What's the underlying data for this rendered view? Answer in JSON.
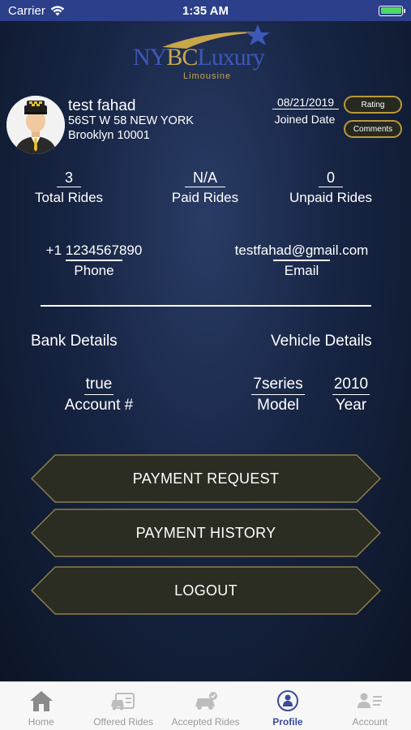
{
  "status_bar": {
    "carrier": "Carrier",
    "time": "1:35 AM"
  },
  "logo": {
    "main_blue": "NY",
    "main_gold": "BC",
    "main_rest": "Luxury",
    "sub": "Limousine"
  },
  "profile": {
    "name": "test fahad",
    "address_line1": "56ST W 58 NEW YORK",
    "address_line2": "Brooklyn 10001",
    "joined_date": "08/21/2019",
    "joined_label": "Joined Date",
    "rating_button": "Rating",
    "comments_button": "Comments"
  },
  "stats": [
    {
      "value": "3",
      "label": "Total Rides"
    },
    {
      "value": "N/A",
      "label": "Paid Rides"
    },
    {
      "value": "0",
      "label": "Unpaid Rides"
    }
  ],
  "contact": {
    "phone": "+1 1234567890",
    "phone_label": "Phone",
    "email": "testfahad@gmail.com",
    "email_label": "Email"
  },
  "bank": {
    "title": "Bank Details",
    "account_value": "true",
    "account_label": "Account #"
  },
  "vehicle": {
    "title": "Vehicle Details",
    "model_value": "7series",
    "model_label": "Model",
    "year_value": "2010",
    "year_label": "Year"
  },
  "actions": {
    "payment_request": "PAYMENT REQUEST",
    "payment_history": "PAYMENT HISTORY",
    "logout": "LOGOUT"
  },
  "tabs": [
    {
      "label": "Home",
      "icon": "home-icon"
    },
    {
      "label": "Offered Rides",
      "icon": "car-icon"
    },
    {
      "label": "Accepted Rides",
      "icon": "car-check-icon"
    },
    {
      "label": "Profile",
      "icon": "profile-icon",
      "active": true
    },
    {
      "label": "Account",
      "icon": "account-icon"
    }
  ],
  "colors": {
    "gold": "#b89a3a",
    "status_bar": "#2b3f8a",
    "tab_active": "#3b4a9c"
  }
}
